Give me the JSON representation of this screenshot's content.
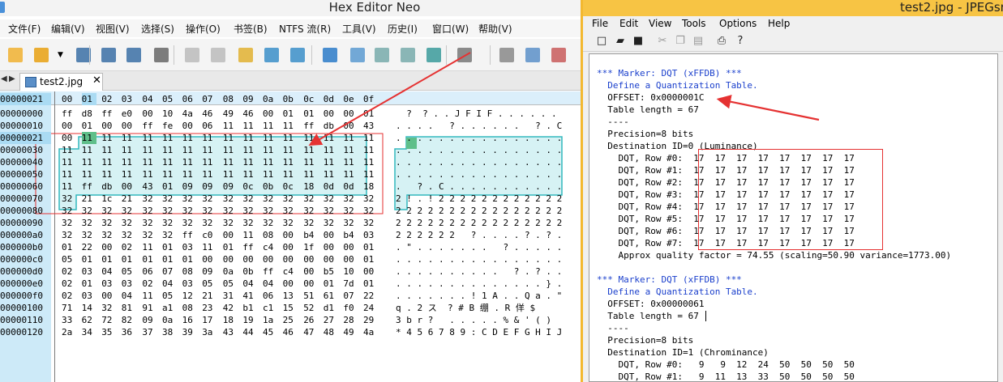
{
  "hex_editor": {
    "title": "Hex Editor Neo",
    "menu": [
      "文件(F)",
      "编辑(V)",
      "视图(V)",
      "选择(S)",
      "操作(O)",
      "书签(B)",
      "NTFS 流(R)",
      "工具(V)",
      "历史(I)",
      "窗口(W)",
      "帮助(V)"
    ],
    "toolbar_icons": [
      "new-file-icon",
      "open-folder-icon",
      "dropdown-arrow-icon",
      "save-icon",
      "save-as-icon",
      "save-all-icon",
      "print-icon",
      "undo-icon",
      "redo-icon",
      "edit-icon",
      "copy-to-icon",
      "paste-from-icon",
      "export-icon",
      "find-icon",
      "find-next-icon",
      "find-prev-icon",
      "select-icon",
      "tools-icon",
      "pattern-icon",
      "compare-icon",
      "structure-icon"
    ],
    "nav_left": "◀",
    "nav_right": "▶",
    "tab_label": "test2.jpg",
    "tab_close": "✕",
    "header_offset": "00000021",
    "column_headers": [
      "00",
      "01",
      "02",
      "03",
      "04",
      "05",
      "06",
      "07",
      "08",
      "09",
      "0a",
      "0b",
      "0c",
      "0d",
      "0e",
      "0f"
    ],
    "rows": [
      {
        "addr": "00000000",
        "hex": [
          "ff",
          "d8",
          "ff",
          "e0",
          "00",
          "10",
          "4a",
          "46",
          "49",
          "46",
          "00",
          "01",
          "01",
          "00",
          "00",
          "01"
        ],
        "ascii": "  ?  ? . . J F I F . . . . . ."
      },
      {
        "addr": "00000010",
        "hex": [
          "00",
          "01",
          "00",
          "00",
          "ff",
          "fe",
          "00",
          "06",
          "11",
          "11",
          "11",
          "11",
          "ff",
          "db",
          "00",
          "43"
        ],
        "ascii": ". . . .   ? . . . . . .   ? . C"
      },
      {
        "addr": "00000021",
        "hex": [
          "00",
          "11",
          "11",
          "11",
          "11",
          "11",
          "11",
          "11",
          "11",
          "11",
          "11",
          "11",
          "11",
          "11",
          "11",
          "11"
        ],
        "ascii": ". . . . . . . . . . . . . . . ."
      },
      {
        "addr": "00000030",
        "hex": [
          "11",
          "11",
          "11",
          "11",
          "11",
          "11",
          "11",
          "11",
          "11",
          "11",
          "11",
          "11",
          "11",
          "11",
          "11",
          "11"
        ],
        "ascii": ". . . . . . . . . . . . . . . ."
      },
      {
        "addr": "00000040",
        "hex": [
          "11",
          "11",
          "11",
          "11",
          "11",
          "11",
          "11",
          "11",
          "11",
          "11",
          "11",
          "11",
          "11",
          "11",
          "11",
          "11"
        ],
        "ascii": ". . . . . . . . . . . . . . . ."
      },
      {
        "addr": "00000050",
        "hex": [
          "11",
          "11",
          "11",
          "11",
          "11",
          "11",
          "11",
          "11",
          "11",
          "11",
          "11",
          "11",
          "11",
          "11",
          "11",
          "11"
        ],
        "ascii": ". . . . . . . . . . . . . . . ."
      },
      {
        "addr": "00000060",
        "hex": [
          "11",
          "ff",
          "db",
          "00",
          "43",
          "01",
          "09",
          "09",
          "09",
          "0c",
          "0b",
          "0c",
          "18",
          "0d",
          "0d",
          "18"
        ],
        "ascii": ".   ? . C . . . . . . . . . . ."
      },
      {
        "addr": "00000070",
        "hex": [
          "32",
          "21",
          "1c",
          "21",
          "32",
          "32",
          "32",
          "32",
          "32",
          "32",
          "32",
          "32",
          "32",
          "32",
          "32",
          "32"
        ],
        "ascii": "2 ! . ! 2 2 2 2 2 2 2 2 2 2 2 2"
      },
      {
        "addr": "00000080",
        "hex": [
          "32",
          "32",
          "32",
          "32",
          "32",
          "32",
          "32",
          "32",
          "32",
          "32",
          "32",
          "32",
          "32",
          "32",
          "32",
          "32"
        ],
        "ascii": "2 2 2 2 2 2 2 2 2 2 2 2 2 2 2 2"
      },
      {
        "addr": "00000090",
        "hex": [
          "32",
          "32",
          "32",
          "32",
          "32",
          "32",
          "32",
          "32",
          "32",
          "32",
          "32",
          "32",
          "32",
          "32",
          "32",
          "32"
        ],
        "ascii": "2 2 2 2 2 2 2 2 2 2 2 2 2 2 2 2"
      },
      {
        "addr": "000000a0",
        "hex": [
          "32",
          "32",
          "32",
          "32",
          "32",
          "32",
          "ff",
          "c0",
          "00",
          "11",
          "08",
          "00",
          "b4",
          "00",
          "b4",
          "03"
        ],
        "ascii": "2 2 2 2 2 2   ? . . . . ? . ? ."
      },
      {
        "addr": "000000b0",
        "hex": [
          "01",
          "22",
          "00",
          "02",
          "11",
          "01",
          "03",
          "11",
          "01",
          "ff",
          "c4",
          "00",
          "1f",
          "00",
          "00",
          "01"
        ],
        "ascii": ". \" . . . . . . .   ? . . . . ."
      },
      {
        "addr": "000000c0",
        "hex": [
          "05",
          "01",
          "01",
          "01",
          "01",
          "01",
          "01",
          "00",
          "00",
          "00",
          "00",
          "00",
          "00",
          "00",
          "00",
          "01"
        ],
        "ascii": ". . . . . . . . . . . . . . . ."
      },
      {
        "addr": "000000d0",
        "hex": [
          "02",
          "03",
          "04",
          "05",
          "06",
          "07",
          "08",
          "09",
          "0a",
          "0b",
          "ff",
          "c4",
          "00",
          "b5",
          "10",
          "00"
        ],
        "ascii": ". . . . . . . . . .   ? . ? . ."
      },
      {
        "addr": "000000e0",
        "hex": [
          "02",
          "01",
          "03",
          "03",
          "02",
          "04",
          "03",
          "05",
          "05",
          "04",
          "04",
          "00",
          "00",
          "01",
          "7d",
          "01"
        ],
        "ascii": ". . . . . . . . . . . . . . } ."
      },
      {
        "addr": "000000f0",
        "hex": [
          "02",
          "03",
          "00",
          "04",
          "11",
          "05",
          "12",
          "21",
          "31",
          "41",
          "06",
          "13",
          "51",
          "61",
          "07",
          "22"
        ],
        "ascii": ". . . . . . . ! 1 A . . Q a . \""
      },
      {
        "addr": "00000100",
        "hex": [
          "71",
          "14",
          "32",
          "81",
          "91",
          "a1",
          "08",
          "23",
          "42",
          "b1",
          "c1",
          "15",
          "52",
          "d1",
          "f0",
          "24"
        ],
        "ascii": "q . 2 ス  ? # B 绷 . R 佯 $"
      },
      {
        "addr": "00000110",
        "hex": [
          "33",
          "62",
          "72",
          "82",
          "09",
          "0a",
          "16",
          "17",
          "18",
          "19",
          "1a",
          "25",
          "26",
          "27",
          "28",
          "29"
        ],
        "ascii": "3 b r ?   . . . . . % & ' ( )"
      },
      {
        "addr": "00000120",
        "hex": [
          "2a",
          "34",
          "35",
          "36",
          "37",
          "38",
          "39",
          "3a",
          "43",
          "44",
          "45",
          "46",
          "47",
          "48",
          "49",
          "4a"
        ],
        "ascii": "* 4 5 6 7 8 9 : C D E F G H I J"
      }
    ]
  },
  "jpegsnoop": {
    "title": "test2.jpg - JPEGsn",
    "menu": [
      "File",
      "Edit",
      "View",
      "Tools",
      "Options",
      "Help"
    ],
    "toolbar_icons": [
      "new-icon",
      "open-icon",
      "save-icon",
      "cut-icon",
      "copy-icon",
      "paste-icon",
      "print-icon",
      "help-icon"
    ],
    "lines": [
      {
        "text": "*** Marker: DQT (xFFDB) ***",
        "blue": true
      },
      {
        "text": "  Define a Quantization Table.",
        "blue": true
      },
      {
        "text": "  OFFSET: 0x0000001C",
        "blue": false
      },
      {
        "text": "  Table length = 67",
        "blue": false
      },
      {
        "text": "  ----",
        "blue": false
      },
      {
        "text": "  Precision=8 bits",
        "blue": false
      },
      {
        "text": "  Destination ID=0 (Luminance)",
        "blue": false
      },
      {
        "text": "    DQT, Row #0:  17  17  17  17  17  17  17  17",
        "blue": false
      },
      {
        "text": "    DQT, Row #1:  17  17  17  17  17  17  17  17",
        "blue": false
      },
      {
        "text": "    DQT, Row #2:  17  17  17  17  17  17  17  17",
        "blue": false
      },
      {
        "text": "    DQT, Row #3:  17  17  17  17  17  17  17  17",
        "blue": false
      },
      {
        "text": "    DQT, Row #4:  17  17  17  17  17  17  17  17",
        "blue": false
      },
      {
        "text": "    DQT, Row #5:  17  17  17  17  17  17  17  17",
        "blue": false
      },
      {
        "text": "    DQT, Row #6:  17  17  17  17  17  17  17  17",
        "blue": false
      },
      {
        "text": "    DQT, Row #7:  17  17  17  17  17  17  17  17",
        "blue": false
      },
      {
        "text": "    Approx quality factor = 74.55 (scaling=50.90 variance=1773.00)",
        "blue": false
      },
      {
        "text": "",
        "blue": false
      },
      {
        "text": "*** Marker: DQT (xFFDB) ***",
        "blue": true
      },
      {
        "text": "  Define a Quantization Table.",
        "blue": true
      },
      {
        "text": "  OFFSET: 0x00000061",
        "blue": false
      },
      {
        "text": "  Table length = 67",
        "blue": false
      },
      {
        "text": "  ----",
        "blue": false
      },
      {
        "text": "  Precision=8 bits",
        "blue": false
      },
      {
        "text": "  Destination ID=1 (Chrominance)",
        "blue": false
      },
      {
        "text": "    DQT, Row #0:   9   9  12  24  50  50  50  50",
        "blue": false
      },
      {
        "text": "    DQT, Row #1:   9  11  13  33  50  50  50  50",
        "blue": false
      }
    ]
  },
  "colors": {
    "selection_fill": "#d6f2f4",
    "selection_border": "#32b8bd",
    "cursor_fill": "#5fbf8a",
    "annotation_red": "#e53232",
    "address_column": "#cdeaf8",
    "jpegsnoop_title": "#f7c444",
    "jpegsnoop_blue": "#1a3fcc"
  }
}
